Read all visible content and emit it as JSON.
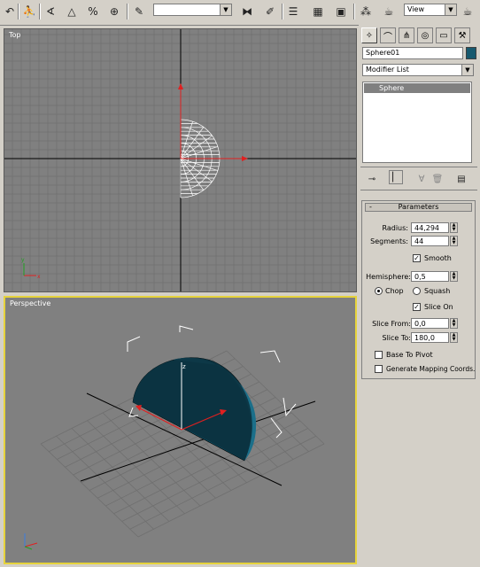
{
  "toolbar": {
    "selection_set_value": "",
    "view_dropdown": "View"
  },
  "viewports": {
    "top": {
      "label": "Top"
    },
    "perspective": {
      "label": "Perspective"
    }
  },
  "command_panel": {
    "object_name": "Sphere01",
    "object_color": "#17596e",
    "modifier_list": "Modifier List",
    "stack_items": [
      "Sphere"
    ],
    "rollout_title": "Parameters",
    "rollout_toggle": "-",
    "params": {
      "radius_label": "Radius:",
      "radius_value": "44,294",
      "segments_label": "Segments:",
      "segments_value": "44",
      "smooth_label": "Smooth",
      "smooth_checked": true,
      "hemisphere_label": "Hemisphere:",
      "hemisphere_value": "0,5",
      "chop_label": "Chop",
      "squash_label": "Squash",
      "chop_selected": true,
      "slice_on_label": "Slice On",
      "slice_on_checked": true,
      "slice_from_label": "Slice From:",
      "slice_from_value": "0,0",
      "slice_to_label": "Slice To:",
      "slice_to_value": "180,0",
      "base_to_pivot_label": "Base To Pivot",
      "base_to_pivot_checked": false,
      "gen_mapping_label": "Generate Mapping Coords.",
      "gen_mapping_checked": false
    }
  },
  "colors": {
    "viewport_bg": "#808080",
    "active_viewport_border": "#e6d33c",
    "sphere_color": "#17596e",
    "axis_x": "#e02020",
    "axis_y": "#20a020"
  }
}
